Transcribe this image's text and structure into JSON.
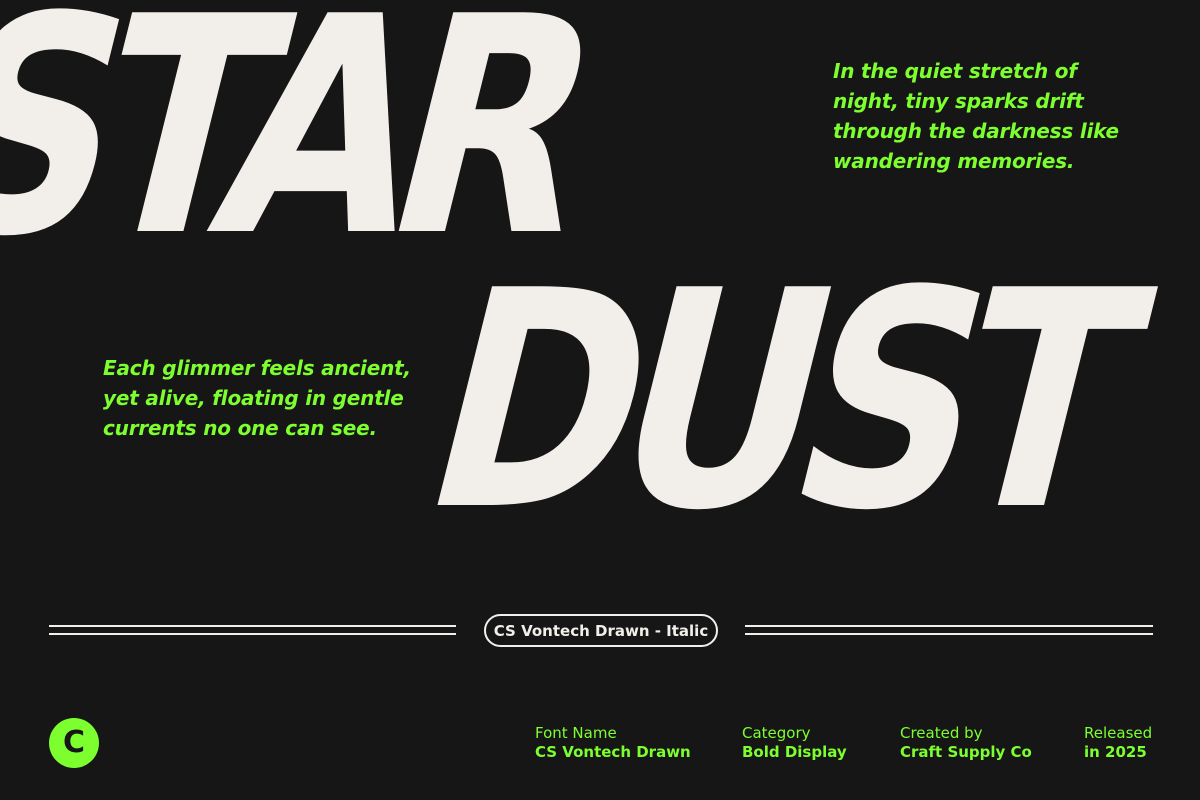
{
  "hero": {
    "line1": "STAR",
    "line2": "DUST"
  },
  "quotes": {
    "top": "In the quiet stretch of\nnight, tiny sparks drift\nthrough the darkness like\nwandering memories.",
    "left": "Each glimmer feels ancient,\nyet alive, floating in gentle\ncurrents no one can see."
  },
  "style_pill": "CS Vontech Drawn - Italic",
  "logo_letter": "C",
  "meta": [
    {
      "label": "Font Name",
      "value": "CS Vontech Drawn"
    },
    {
      "label": "Category",
      "value": "Bold Display"
    },
    {
      "label": "Created by",
      "value": "Craft Supply Co"
    },
    {
      "label": "Released",
      "value": "in 2025"
    }
  ],
  "colors": {
    "background": "#161616",
    "foreground": "#f2efea",
    "accent": "#7dff2f"
  }
}
